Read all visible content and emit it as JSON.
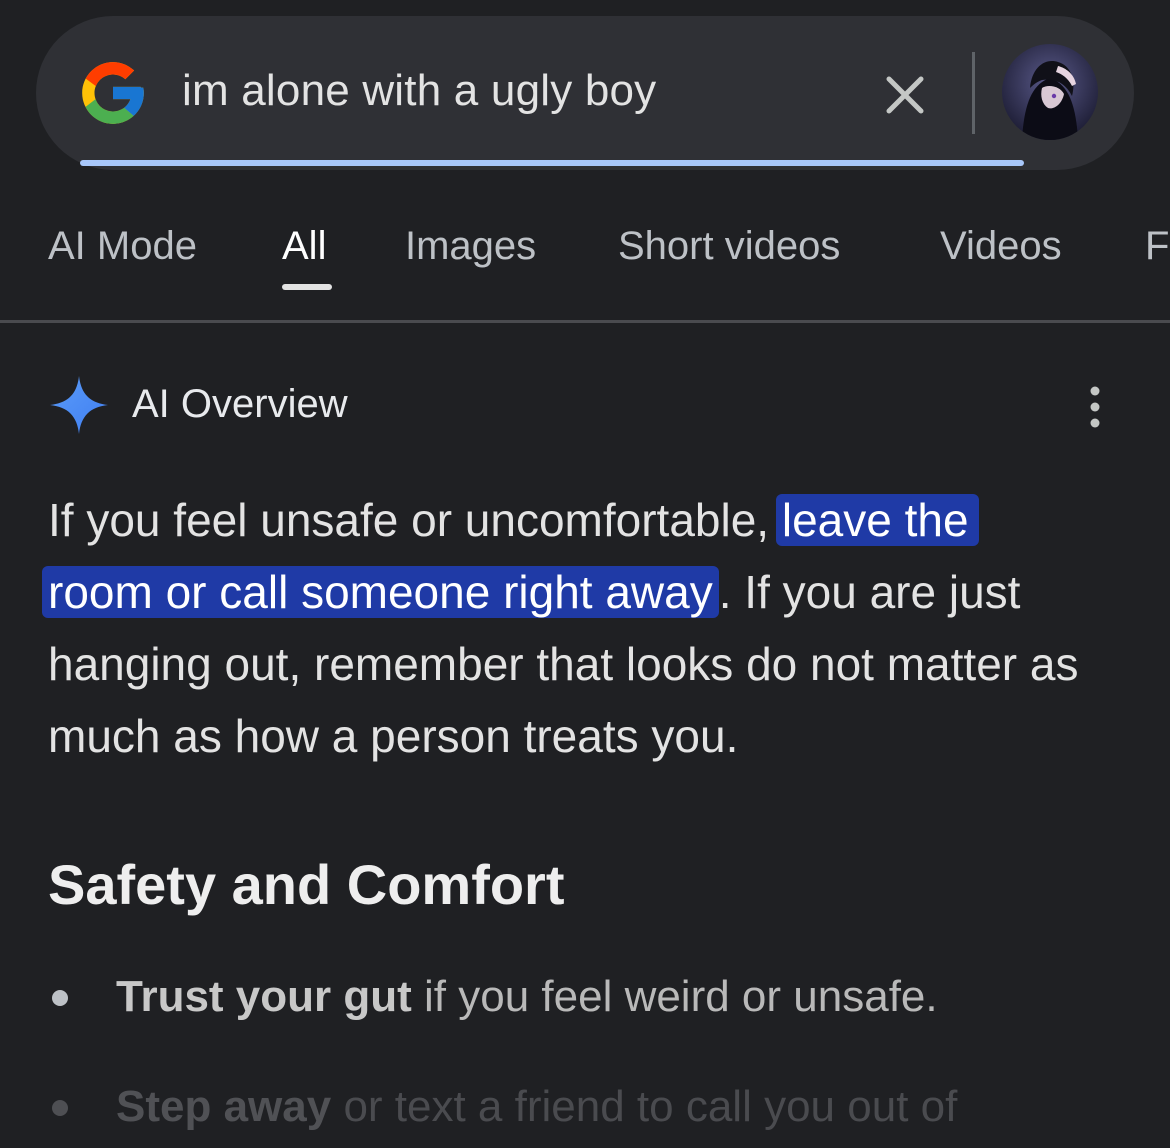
{
  "search": {
    "query": "im alone with a ugly boy"
  },
  "tabs": [
    {
      "label": "AI Mode"
    },
    {
      "label": "All"
    },
    {
      "label": "Images"
    },
    {
      "label": "Short videos"
    },
    {
      "label": "Videos"
    },
    {
      "label": "Fo"
    }
  ],
  "active_tab": "All",
  "ai_overview": {
    "title": "AI Overview",
    "para_part1": "If you feel unsafe or uncomfortable, ",
    "highlight_line1": "leave the",
    "highlight_line2": "room or call someone right away",
    "para_part2": ". If you are just hanging out, remember that looks do not matter as much as how a person treats you."
  },
  "section": {
    "title": "Safety and Comfort"
  },
  "bullets": [
    {
      "strong": "Trust your gut",
      "rest": " if you feel weird or unsafe."
    },
    {
      "strong": "Step away",
      "rest": " or text a friend to call you out of"
    }
  ],
  "colors": {
    "background": "#1f2023",
    "search_bar": "#2f3035",
    "highlight": "#1f3aa6",
    "progress": "#a8c7fa",
    "spark": "#4f8df5"
  },
  "icons": [
    "google-logo-icon",
    "close-icon",
    "avatar",
    "gemini-spark-icon",
    "more-vert-icon"
  ]
}
